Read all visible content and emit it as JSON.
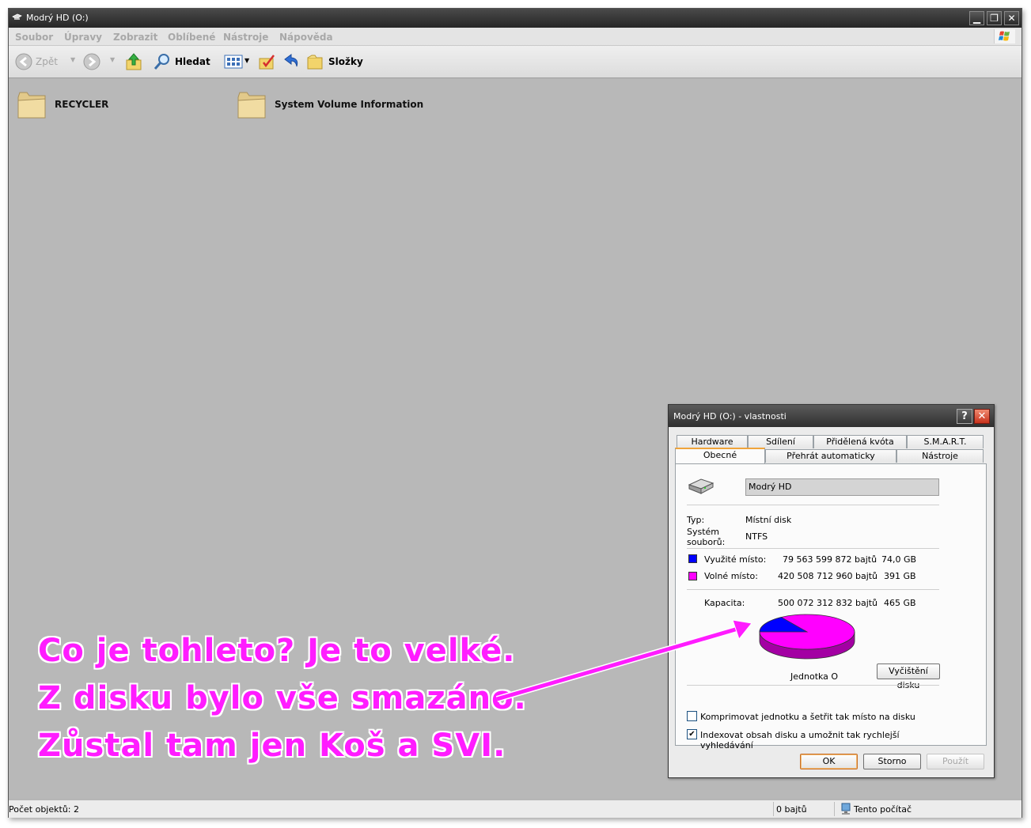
{
  "window": {
    "title": "Modrý HD (O:)",
    "controls": [
      "minimize",
      "maximize",
      "close"
    ]
  },
  "menu": [
    "Soubor",
    "Úpravy",
    "Zobrazit",
    "Oblíbené",
    "Nástroje",
    "Nápověda"
  ],
  "toolbar": {
    "back_label": "Zpět",
    "search_label": "Hledat",
    "folders_label": "Složky"
  },
  "folders": [
    {
      "name": "RECYCLER"
    },
    {
      "name": "System Volume Information"
    }
  ],
  "status": {
    "count": "Počet objektů: 2",
    "size": "0 bajtů",
    "zone": "Tento počítač"
  },
  "dialog": {
    "title": "Modrý HD (O:) - vlastnosti",
    "tabs_top": [
      "Hardware",
      "Sdílení",
      "Přidělená kvóta",
      "S.M.A.R.T."
    ],
    "tabs_bottom": [
      "Obecné",
      "Přehrát automaticky",
      "Nástroje"
    ],
    "active_tab": "Obecné",
    "drive_name": "Modrý HD",
    "type_label": "Typ:",
    "type_value": "Místní disk",
    "fs_label": "Systém souborů:",
    "fs_value": "NTFS",
    "used_label": "Využité místo:",
    "used_bytes": "79 563 599 872 bajtů",
    "used_gb": "74,0 GB",
    "free_label": "Volné místo:",
    "free_bytes": "420 508 712 960 bajtů",
    "free_gb": "391 GB",
    "capacity_label": "Kapacita:",
    "capacity_bytes": "500 072 312 832 bajtů",
    "capacity_gb": "465 GB",
    "drive_caption": "Jednotka O",
    "cleanup_button": "Vyčištění disku",
    "compress_label": "Komprimovat jednotku a šetřit tak místo na disku",
    "compress_checked": false,
    "index_label": "Indexovat obsah disku a umožnit tak rychlejší vyhledávání",
    "index_checked": true,
    "ok": "OK",
    "cancel": "Storno",
    "apply": "Použít",
    "colors": {
      "used": "#0000ff",
      "free": "#ff00ff"
    },
    "used_fraction": 0.159
  },
  "annotation": {
    "lines": [
      "Co je tohleto? Je to velké.",
      "Z disku bylo vše smazáno.",
      "Zůstal tam jen Koš a SVI."
    ],
    "color": "#ff1cff"
  }
}
